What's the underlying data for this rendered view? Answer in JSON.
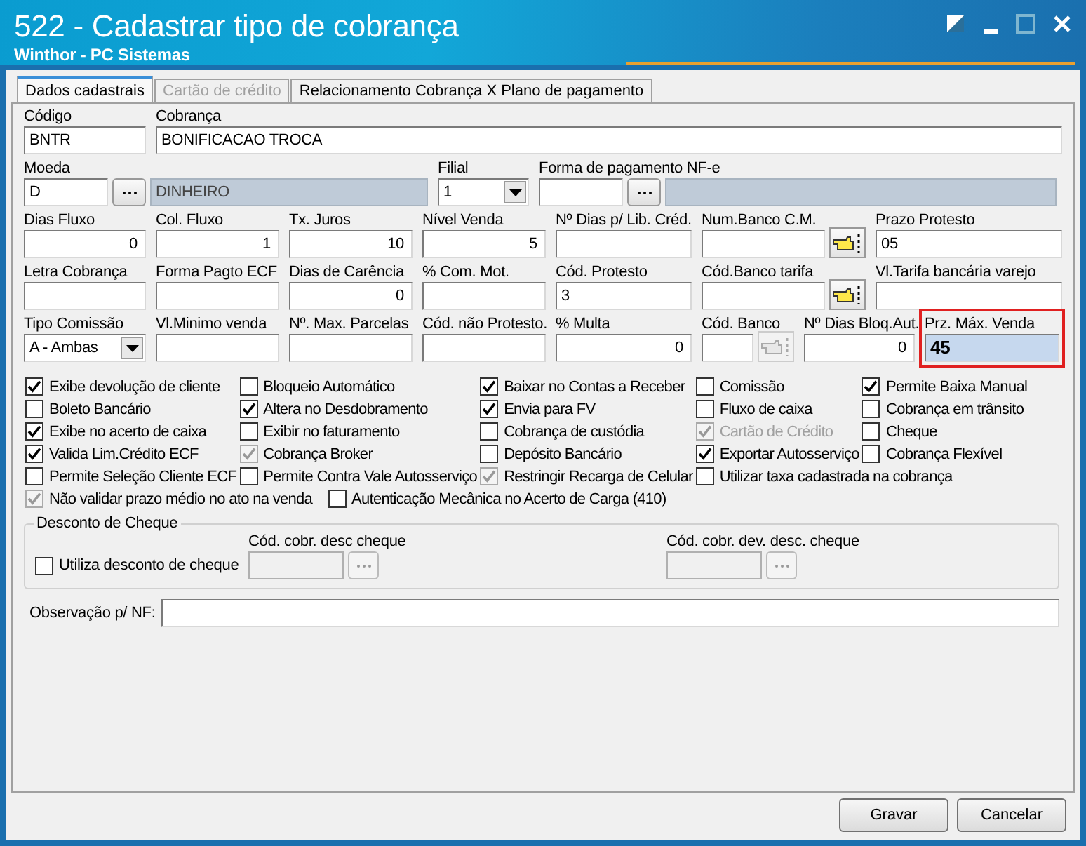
{
  "window": {
    "title": "522 - Cadastrar tipo de cobrança",
    "subtitle": "Winthor - PC Sistemas"
  },
  "tabs": [
    {
      "label": "Dados cadastrais",
      "selected": true,
      "disabled": false
    },
    {
      "label": "Cartão de crédito",
      "selected": false,
      "disabled": true
    },
    {
      "label": "Relacionamento Cobrança X Plano de pagamento",
      "selected": false,
      "disabled": false
    }
  ],
  "field_rows": [
    [
      {
        "label": "Código",
        "kind": "text",
        "value": "BNTR",
        "highlighted": false
      },
      {
        "label": "Cobrança",
        "kind": "text",
        "value": "BONIFICACAO TROCA",
        "highlighted": false
      }
    ],
    [
      {
        "label": "Moeda",
        "kind": "lookup",
        "value": "D",
        "description": "DINHEIRO",
        "highlighted": false
      },
      {
        "label": "Filial",
        "kind": "select",
        "value": "1",
        "highlighted": false
      },
      {
        "label": "Forma de pagamento NF-e",
        "kind": "lookup",
        "highlighted": false
      }
    ],
    [
      {
        "label": "Dias Fluxo",
        "kind": "number",
        "value": "0",
        "highlighted": false
      },
      {
        "label": "Col. Fluxo",
        "kind": "number",
        "value": "1",
        "highlighted": false
      },
      {
        "label": "Tx. Juros",
        "kind": "number",
        "value": "10",
        "highlighted": false
      },
      {
        "label": "Nível Venda",
        "kind": "number",
        "value": "5",
        "highlighted": false
      },
      {
        "label": "Nº Dias p/ Lib. Créd.",
        "kind": "text",
        "highlighted": false
      },
      {
        "label": "Num.Banco C.M.",
        "kind": "picker",
        "button_disabled": false,
        "highlighted": false
      },
      {
        "label": "Prazo Protesto",
        "kind": "text",
        "value": "05",
        "highlighted": false
      }
    ],
    [
      {
        "label": "Letra Cobrança",
        "kind": "text",
        "highlighted": false
      },
      {
        "label": "Forma Pagto ECF",
        "kind": "text",
        "highlighted": false
      },
      {
        "label": "Dias de Carência",
        "kind": "number",
        "value": "0",
        "highlighted": false
      },
      {
        "label": "% Com. Mot.",
        "kind": "text",
        "highlighted": false
      },
      {
        "label": "Cód. Protesto",
        "kind": "text",
        "value": "3",
        "highlighted": false
      },
      {
        "label": "Cód.Banco tarifa",
        "kind": "picker",
        "button_disabled": false,
        "highlighted": false
      },
      {
        "label": "Vl.Tarifa bancária varejo",
        "kind": "text",
        "highlighted": false
      }
    ],
    [
      {
        "label": "Tipo Comissão",
        "kind": "select",
        "value": "A - Ambas",
        "highlighted": false
      },
      {
        "label": "Vl.Minimo venda",
        "kind": "text",
        "highlighted": false
      },
      {
        "label": "Nº. Max. Parcelas",
        "kind": "text",
        "highlighted": false
      },
      {
        "label": "Cód. não Protesto.",
        "kind": "text",
        "highlighted": false
      },
      {
        "label": "% Multa",
        "kind": "number",
        "value": "0",
        "highlighted": false
      },
      {
        "label": "Cód. Banco",
        "kind": "picker",
        "button_disabled": true,
        "highlighted": false
      },
      {
        "label": "Nº Dias Bloq.Aut.",
        "kind": "number",
        "value": "0",
        "highlighted": false
      },
      {
        "label": "Prz. Máx. Venda",
        "kind": "text",
        "value": "45",
        "highlighted": true
      }
    ]
  ],
  "option_rows": [
    [
      {
        "label": "Exibe devolução de cliente",
        "checked": true,
        "disabled": false
      },
      {
        "label": "Bloqueio Automático",
        "checked": false,
        "disabled": false
      },
      {
        "label": "Baixar no Contas a Receber",
        "checked": true,
        "disabled": false
      },
      {
        "label": "Comissão",
        "checked": false,
        "disabled": false
      },
      {
        "label": "Permite Baixa Manual",
        "checked": true,
        "disabled": false
      }
    ],
    [
      {
        "label": "Boleto Bancário",
        "checked": false,
        "disabled": false
      },
      {
        "label": "Altera no Desdobramento",
        "checked": true,
        "disabled": false
      },
      {
        "label": "Envia para FV",
        "checked": true,
        "disabled": false
      },
      {
        "label": "Fluxo de caixa",
        "checked": false,
        "disabled": false
      },
      {
        "label": "Cobrança em trânsito",
        "checked": false,
        "disabled": false
      }
    ],
    [
      {
        "label": "Exibe no acerto de caixa",
        "checked": true,
        "disabled": false
      },
      {
        "label": "Exibir no faturamento",
        "checked": false,
        "disabled": false
      },
      {
        "label": "Cobrança de custódia",
        "checked": false,
        "disabled": false
      },
      {
        "label": "Cartão de Crédito",
        "checked": true,
        "disabled": true
      },
      {
        "label": "Cheque",
        "checked": false,
        "disabled": false
      }
    ],
    [
      {
        "label": "Valida Lim.Crédito ECF",
        "checked": true,
        "disabled": false
      },
      {
        "label": "Cobrança Broker",
        "checked": true,
        "disabled": true
      },
      {
        "label": "Depósito Bancário",
        "checked": false,
        "disabled": false
      },
      {
        "label": "Exportar Autosserviço",
        "checked": true,
        "disabled": false
      },
      {
        "label": "Cobrança Flexível",
        "checked": false,
        "disabled": false
      }
    ],
    [
      {
        "label": "Permite Seleção Cliente ECF",
        "checked": false,
        "disabled": false
      },
      {
        "label": "Permite Contra Vale Autosserviço",
        "checked": false,
        "disabled": false
      },
      {
        "label": "Restringir Recarga de Celular",
        "checked": true,
        "disabled": true
      },
      {
        "label": "Utilizar taxa cadastrada na cobrança",
        "checked": false,
        "disabled": false
      }
    ],
    [
      {
        "label": "Não validar prazo médio no ato na venda",
        "checked": true,
        "disabled": true
      },
      {
        "label": "Autenticação Mecânica no Acerto de Carga (410)",
        "checked": false,
        "disabled": false
      }
    ]
  ],
  "cheque_discount": {
    "title": "Desconto de Cheque",
    "option": {
      "label": "Utiliza desconto de cheque",
      "checked": false
    },
    "fields": [
      {
        "label": "Cód. cobr. desc cheque",
        "disabled": true
      },
      {
        "label": "Cód. cobr. dev. desc. cheque",
        "disabled": true
      }
    ]
  },
  "observation": {
    "label": "Observação p/ NF:"
  },
  "buttons": [
    {
      "label": "Gravar"
    },
    {
      "label": "Cancelar"
    }
  ]
}
